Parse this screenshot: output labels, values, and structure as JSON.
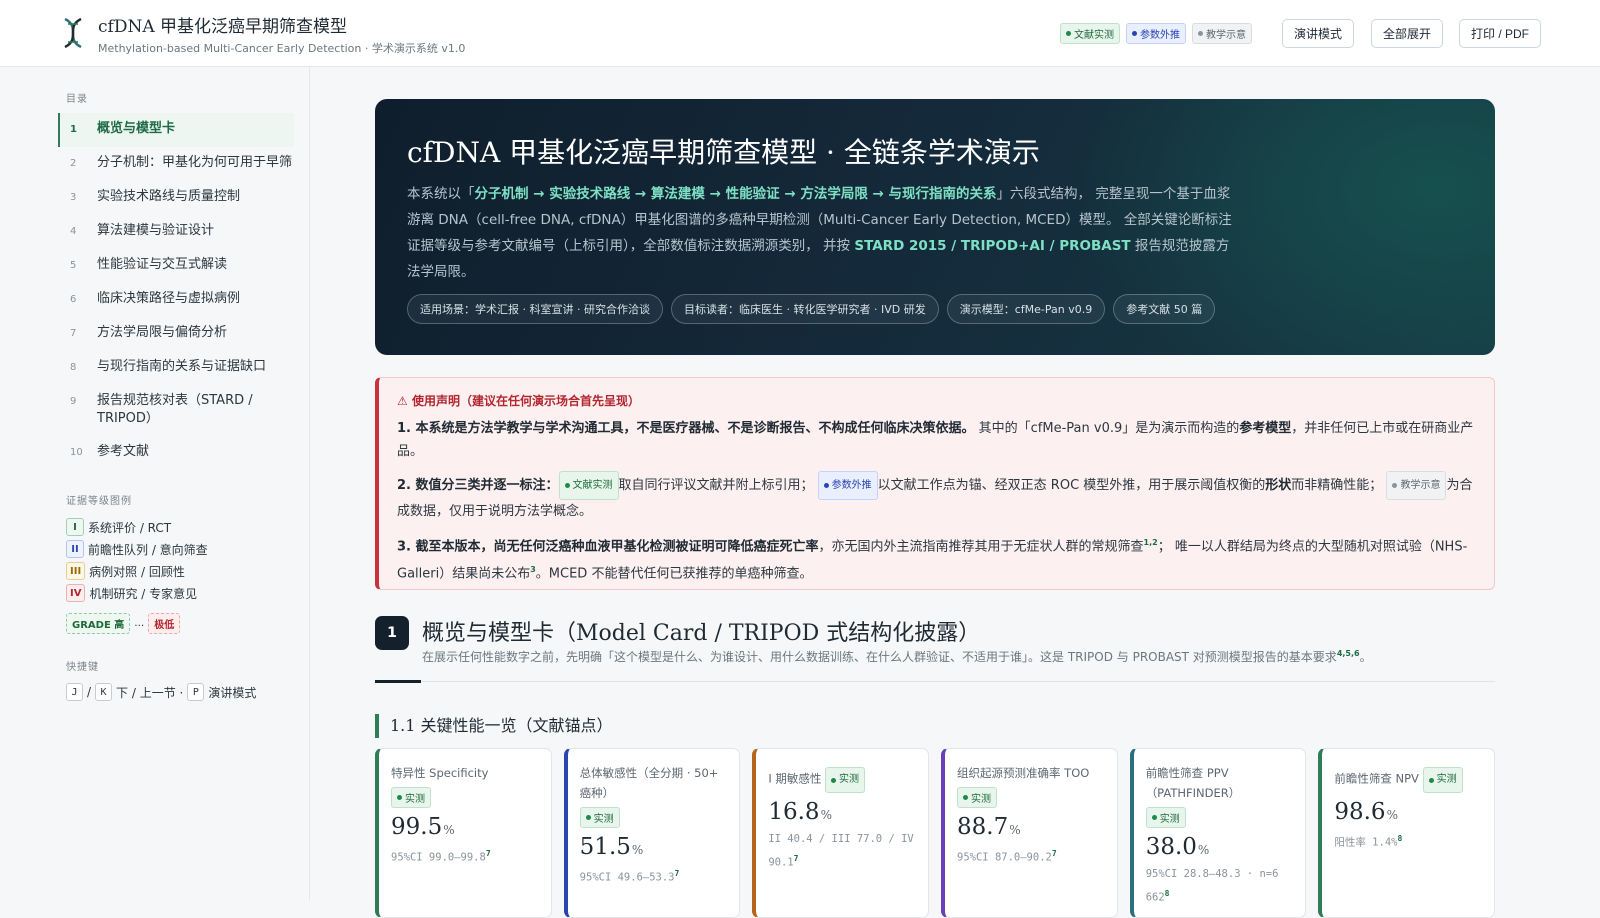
{
  "header": {
    "title": "cfDNA 甲基化泛癌早期筛查模型",
    "subtitle": "Methylation-based Multi-Cancer Early Detection · 学术演示系统 v1.0",
    "badges": [
      "文献实测",
      "参数外推",
      "教学示意"
    ],
    "buttons": {
      "present": "演讲模式",
      "expand_all": "全部展开",
      "print": "打印 / PDF"
    }
  },
  "sidebar": {
    "toc_heading": "目录",
    "items": [
      {
        "num": "1",
        "label": "概览与模型卡",
        "active": true
      },
      {
        "num": "2",
        "label": "分子机制：甲基化为何可用于早筛"
      },
      {
        "num": "3",
        "label": "实验技术路线与质量控制"
      },
      {
        "num": "4",
        "label": "算法建模与验证设计"
      },
      {
        "num": "5",
        "label": "性能验证与交互式解读"
      },
      {
        "num": "6",
        "label": "临床决策路径与虚拟病例"
      },
      {
        "num": "7",
        "label": "方法学局限与偏倚分析"
      },
      {
        "num": "8",
        "label": "与现行指南的关系与证据缺口"
      },
      {
        "num": "9",
        "label": "报告规范核对表（STARD / TRIPOD）"
      },
      {
        "num": "10",
        "label": "参考文献"
      }
    ],
    "evidence_heading": "证据等级图例",
    "evidence": [
      {
        "tag": "I",
        "label": "系统评价 / RCT"
      },
      {
        "tag": "II",
        "label": "前瞻性队列 / 意向筛查"
      },
      {
        "tag": "III",
        "label": "病例对照 / 回顾性"
      },
      {
        "tag": "IV",
        "label": "机制研究 / 专家意见"
      }
    ],
    "grade_high": "GRADE 高",
    "grade_sep": "…",
    "grade_low": "极低",
    "shortcut_heading": "快捷键",
    "shortcuts": {
      "k1": "J",
      "sep1": "/",
      "k2": "K",
      "t1": "下 / 上一节 ·",
      "k3": "P",
      "t2": "演讲模式"
    }
  },
  "hero": {
    "title": "cfDNA 甲基化泛癌早期筛查模型 · 全链条学术演示",
    "desc_1": "本系统以「",
    "desc_flow": "分子机制 → 实验技术路线 → 算法建模 → 性能验证 → 方法学局限 → 与现行指南的关系",
    "desc_2": "」六段式结构， 完整呈现一个基于血浆游离 DNA（cell-free DNA, cfDNA）甲基化图谱的多癌种早期检测（Multi-Cancer Early Detection, MCED）模型。 全部关键论断标注证据等级与参考文献编号（上标引用），全部数值标注数据溯源类别， 并按 ",
    "desc_std": "STARD 2015 / TRIPOD+AI / PROBAST",
    "desc_3": " 报告规范披露方法学局限。",
    "tags": [
      "适用场景：学术汇报 · 科室宣讲 · 研究合作洽谈",
      "目标读者：临床医生 · 转化医学研究者 · IVD 研发",
      "演示模型：cfMe-Pan v0.9",
      "参考文献 50 篇"
    ]
  },
  "notice": {
    "title": "使用声明（建议在任何演示场合首先呈现）",
    "p1_bold": "1. 本系统是方法学教学与学术沟通工具，不是医疗器械、不是诊断报告、不构成任何临床决策依据。",
    "p1_a": " 其中的「cfMe-Pan v0.9」是为演示而构造的",
    "p1_b": "参考模型",
    "p1_c": "，并非任何已上市或在研商业产品。",
    "p2_bold": "2. 数值分三类并逐一标注：",
    "b_real": "文献实测",
    "p2_a": "取自同行评议文献并附上标引用；",
    "b_ext": "参数外推",
    "p2_b": "以文献工作点为锚、经双正态 ROC 模型外推，用于展示阈值权衡的",
    "p2_c": "形状",
    "p2_d": "而非精确性能；",
    "b_demo": "教学示意",
    "p2_e": "为合成数据，仅用于说明方法学概念。",
    "p3_bold": "3. 截至本版本，尚无任何泛癌种血液甲基化检测被证明可降低癌症死亡率",
    "p3_a": "，亦无国内外主流指南推荐其用于无症状人群的常规筛查",
    "p3_ref1": "1,2",
    "p3_b": "； 唯一以人群结局为终点的大型随机对照试验（NHS-Galleri）结果尚未公布",
    "p3_ref2": "3",
    "p3_c": "。MCED 不能替代任何已获推荐的单癌种筛查。"
  },
  "section": {
    "num": "1",
    "title": "概览与模型卡（Model Card / TRIPOD 式结构化披露）",
    "sub": "在展示任何性能数字之前，先明确「这个模型是什么、为谁设计、用什么数据训练、在什么人群验证、不适用于谁」。这是 TRIPOD 与 PROBAST 对预测模型报告的基本要求",
    "sub_ref": "4,5,6",
    "sub_end": "。",
    "subhead": "1.1 关键性能一览（文献锚点）"
  },
  "cards": [
    {
      "label": "特异性 Specificity",
      "badge": "实测",
      "value": "99.5",
      "unit": "%",
      "note": "95%CI 99.0–99.8",
      "ref": "7",
      "color": "#2e7d56"
    },
    {
      "label": "总体敏感性（全分期 · 50+ 癌种）",
      "badge": "实测",
      "value": "51.5",
      "unit": "%",
      "note": "95%CI 49.6–53.3",
      "ref": "7",
      "color": "#2a45b0"
    },
    {
      "label": "I 期敏感性",
      "badge": "实测",
      "value": "16.8",
      "unit": "%",
      "note": "II 40.4 / III 77.0 / IV 90.1",
      "ref": "7",
      "color": "#b5651d"
    },
    {
      "label": "组织起源预测准确率 TOO",
      "badge": "实测",
      "value": "88.7",
      "unit": "%",
      "note": "95%CI 87.0–90.2",
      "ref": "7",
      "color": "#6b3fb5"
    },
    {
      "label": "前瞻性筛查 PPV（PATHFINDER）",
      "badge": "实测",
      "value": "38.0",
      "unit": "%",
      "note": "95%CI 28.8–48.3 · n=6 662",
      "ref": "8",
      "color": "#2a6f7a"
    },
    {
      "label": "前瞻性筛查 NPV",
      "badge": "实测",
      "value": "98.6",
      "unit": "%",
      "note": "阳性率 1.4%",
      "ref": "8",
      "color": "#2e7d56"
    }
  ]
}
